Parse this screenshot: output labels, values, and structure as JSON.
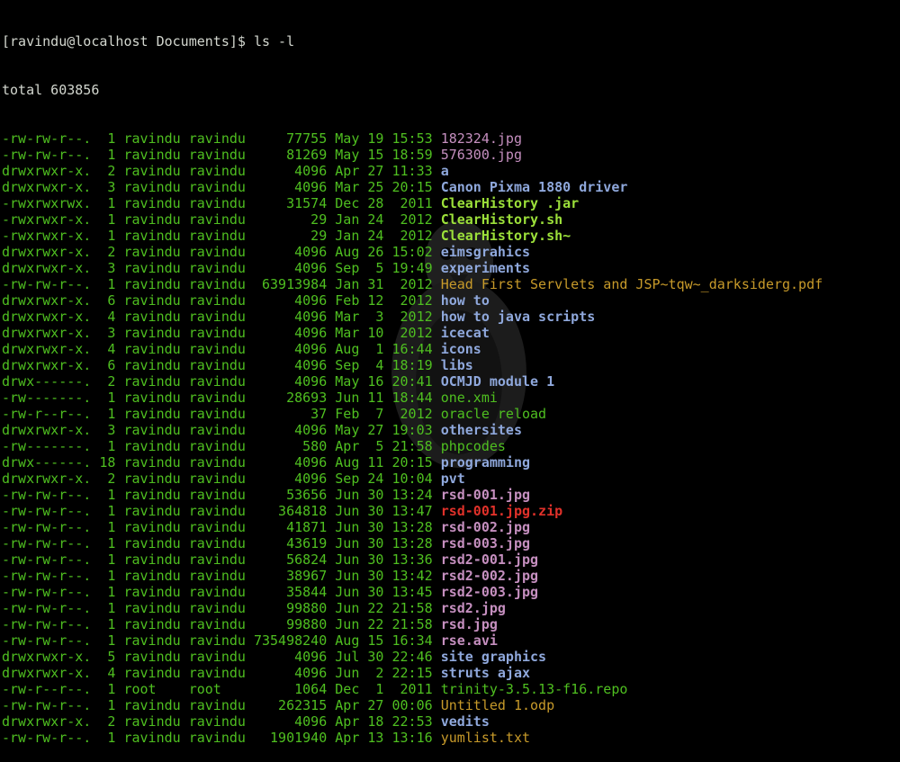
{
  "terminal": {
    "prompt": "[ravindu@localhost Documents]$ ls -l",
    "total": "total 603856",
    "rows": [
      {
        "perms": "-rw-rw-r--.",
        "links": " 1",
        "owner": "ravindu",
        "group": "ravindu",
        "size": "    77755",
        "date": "May 19 15:53",
        "name": "182324.jpg",
        "type": "img"
      },
      {
        "perms": "-rw-rw-r--.",
        "links": " 1",
        "owner": "ravindu",
        "group": "ravindu",
        "size": "    81269",
        "date": "May 15 18:59",
        "name": "576300.jpg",
        "type": "img"
      },
      {
        "perms": "drwxrwxr-x.",
        "links": " 2",
        "owner": "ravindu",
        "group": "ravindu",
        "size": "     4096",
        "date": "Apr 27 11:33",
        "name": "a",
        "type": "dir"
      },
      {
        "perms": "drwxrwxr-x.",
        "links": " 3",
        "owner": "ravindu",
        "group": "ravindu",
        "size": "     4096",
        "date": "Mar 25 20:15",
        "name": "Canon Pixma 1880 driver",
        "type": "dir"
      },
      {
        "perms": "-rwxrwxrwx.",
        "links": " 1",
        "owner": "ravindu",
        "group": "ravindu",
        "size": "    31574",
        "date": "Dec 28  2011",
        "name": "ClearHistory .jar",
        "type": "exec"
      },
      {
        "perms": "-rwxrwxr-x.",
        "links": " 1",
        "owner": "ravindu",
        "group": "ravindu",
        "size": "       29",
        "date": "Jan 24  2012",
        "name": "ClearHistory.sh",
        "type": "exec"
      },
      {
        "perms": "-rwxrwxr-x.",
        "links": " 1",
        "owner": "ravindu",
        "group": "ravindu",
        "size": "       29",
        "date": "Jan 24  2012",
        "name": "ClearHistory.sh~",
        "type": "exec"
      },
      {
        "perms": "drwxrwxr-x.",
        "links": " 2",
        "owner": "ravindu",
        "group": "ravindu",
        "size": "     4096",
        "date": "Aug 26 15:02",
        "name": "eimsgrahics",
        "type": "dir"
      },
      {
        "perms": "drwxrwxr-x.",
        "links": " 3",
        "owner": "ravindu",
        "group": "ravindu",
        "size": "     4096",
        "date": "Sep  5 19:49",
        "name": "experiments",
        "type": "dir"
      },
      {
        "perms": "-rw-rw-r--.",
        "links": " 1",
        "owner": "ravindu",
        "group": "ravindu",
        "size": " 63913984",
        "date": "Jan 31  2012",
        "name": "Head First Servlets and JSP~tqw~_darksiderg.pdf",
        "type": "doc"
      },
      {
        "perms": "drwxrwxr-x.",
        "links": " 6",
        "owner": "ravindu",
        "group": "ravindu",
        "size": "     4096",
        "date": "Feb 12  2012",
        "name": "how to",
        "type": "dir"
      },
      {
        "perms": "drwxrwxr-x.",
        "links": " 4",
        "owner": "ravindu",
        "group": "ravindu",
        "size": "     4096",
        "date": "Mar  3  2012",
        "name": "how to java scripts",
        "type": "dir"
      },
      {
        "perms": "drwxrwxr-x.",
        "links": " 3",
        "owner": "ravindu",
        "group": "ravindu",
        "size": "     4096",
        "date": "Mar 10  2012",
        "name": "icecat",
        "type": "dir"
      },
      {
        "perms": "drwxrwxr-x.",
        "links": " 4",
        "owner": "ravindu",
        "group": "ravindu",
        "size": "     4096",
        "date": "Aug  1 16:44",
        "name": "icons",
        "type": "dir"
      },
      {
        "perms": "drwxrwxr-x.",
        "links": " 6",
        "owner": "ravindu",
        "group": "ravindu",
        "size": "     4096",
        "date": "Sep  4 18:19",
        "name": "libs",
        "type": "dir"
      },
      {
        "perms": "drwx------.",
        "links": " 2",
        "owner": "ravindu",
        "group": "ravindu",
        "size": "     4096",
        "date": "May 16 20:41",
        "name": "OCMJD module 1",
        "type": "other"
      },
      {
        "perms": "-rw-------.",
        "links": " 1",
        "owner": "ravindu",
        "group": "ravindu",
        "size": "    28693",
        "date": "Jun 11 18:44",
        "name": "one.xmi",
        "type": "file"
      },
      {
        "perms": "-rw-r--r--.",
        "links": " 1",
        "owner": "ravindu",
        "group": "ravindu",
        "size": "       37",
        "date": "Feb  7  2012",
        "name": "oracle reload",
        "type": "file"
      },
      {
        "perms": "drwxrwxr-x.",
        "links": " 3",
        "owner": "ravindu",
        "group": "ravindu",
        "size": "     4096",
        "date": "May 27 19:03",
        "name": "othersites",
        "type": "dir"
      },
      {
        "perms": "-rw-------.",
        "links": " 1",
        "owner": "ravindu",
        "group": "ravindu",
        "size": "      580",
        "date": "Apr  5 21:58",
        "name": "phpcodes",
        "type": "file"
      },
      {
        "perms": "drwx------.",
        "links": "18",
        "owner": "ravindu",
        "group": "ravindu",
        "size": "     4096",
        "date": "Aug 11 20:15",
        "name": "programming",
        "type": "dir"
      },
      {
        "perms": "drwxrwxr-x.",
        "links": " 2",
        "owner": "ravindu",
        "group": "ravindu",
        "size": "     4096",
        "date": "Sep 24 10:04",
        "name": "pvt",
        "type": "dir"
      },
      {
        "perms": "-rw-rw-r--.",
        "links": " 1",
        "owner": "ravindu",
        "group": "ravindu",
        "size": "    53656",
        "date": "Jun 30 13:24",
        "name": "rsd-001.jpg",
        "type": "imgb"
      },
      {
        "perms": "-rw-rw-r--.",
        "links": " 1",
        "owner": "ravindu",
        "group": "ravindu",
        "size": "   364818",
        "date": "Jun 30 13:47",
        "name": "rsd-001.jpg.zip",
        "type": "archive"
      },
      {
        "perms": "-rw-rw-r--.",
        "links": " 1",
        "owner": "ravindu",
        "group": "ravindu",
        "size": "    41871",
        "date": "Jun 30 13:28",
        "name": "rsd-002.jpg",
        "type": "imgb"
      },
      {
        "perms": "-rw-rw-r--.",
        "links": " 1",
        "owner": "ravindu",
        "group": "ravindu",
        "size": "    43619",
        "date": "Jun 30 13:28",
        "name": "rsd-003.jpg",
        "type": "imgb"
      },
      {
        "perms": "-rw-rw-r--.",
        "links": " 1",
        "owner": "ravindu",
        "group": "ravindu",
        "size": "    56824",
        "date": "Jun 30 13:36",
        "name": "rsd2-001.jpg",
        "type": "imgb"
      },
      {
        "perms": "-rw-rw-r--.",
        "links": " 1",
        "owner": "ravindu",
        "group": "ravindu",
        "size": "    38967",
        "date": "Jun 30 13:42",
        "name": "rsd2-002.jpg",
        "type": "imgb"
      },
      {
        "perms": "-rw-rw-r--.",
        "links": " 1",
        "owner": "ravindu",
        "group": "ravindu",
        "size": "    35844",
        "date": "Jun 30 13:45",
        "name": "rsd2-003.jpg",
        "type": "imgb"
      },
      {
        "perms": "-rw-rw-r--.",
        "links": " 1",
        "owner": "ravindu",
        "group": "ravindu",
        "size": "    99880",
        "date": "Jun 22 21:58",
        "name": "rsd2.jpg",
        "type": "imgb"
      },
      {
        "perms": "-rw-rw-r--.",
        "links": " 1",
        "owner": "ravindu",
        "group": "ravindu",
        "size": "    99880",
        "date": "Jun 22 21:58",
        "name": "rsd.jpg",
        "type": "imgb"
      },
      {
        "perms": "-rw-rw-r--.",
        "links": " 1",
        "owner": "ravindu",
        "group": "ravindu",
        "size": "735498240",
        "date": "Aug 15 16:34",
        "name": "rse.avi",
        "type": "imgb"
      },
      {
        "perms": "drwxrwxr-x.",
        "links": " 5",
        "owner": "ravindu",
        "group": "ravindu",
        "size": "     4096",
        "date": "Jul 30 22:46",
        "name": "site graphics",
        "type": "dir"
      },
      {
        "perms": "drwxrwxr-x.",
        "links": " 4",
        "owner": "ravindu",
        "group": "ravindu",
        "size": "     4096",
        "date": "Jun  2 22:15",
        "name": "struts ajax",
        "type": "dir"
      },
      {
        "perms": "-rw-r--r--.",
        "links": " 1",
        "owner": "root   ",
        "group": "root   ",
        "size": "     1064",
        "date": "Dec  1  2011",
        "name": "trinity-3.5.13-f16.repo",
        "type": "file"
      },
      {
        "perms": "-rw-rw-r--.",
        "links": " 1",
        "owner": "ravindu",
        "group": "ravindu",
        "size": "   262315",
        "date": "Apr 27 00:06",
        "name": "Untitled 1.odp",
        "type": "doc"
      },
      {
        "perms": "drwxrwxr-x.",
        "links": " 2",
        "owner": "ravindu",
        "group": "ravindu",
        "size": "     4096",
        "date": "Apr 18 22:53",
        "name": "vedits",
        "type": "dir"
      },
      {
        "perms": "-rw-rw-r--.",
        "links": " 1",
        "owner": "ravindu",
        "group": "ravindu",
        "size": "  1901940",
        "date": "Apr 13 13:16",
        "name": "yumlist.txt",
        "type": "doc"
      }
    ]
  },
  "colors": {
    "background": "#000000",
    "meta": "#4fbf20",
    "dir": "#8fa8dc",
    "img": "#c58fbf",
    "exec": "#9ce03a",
    "doc": "#c79a2a",
    "archive": "#e0312a"
  }
}
